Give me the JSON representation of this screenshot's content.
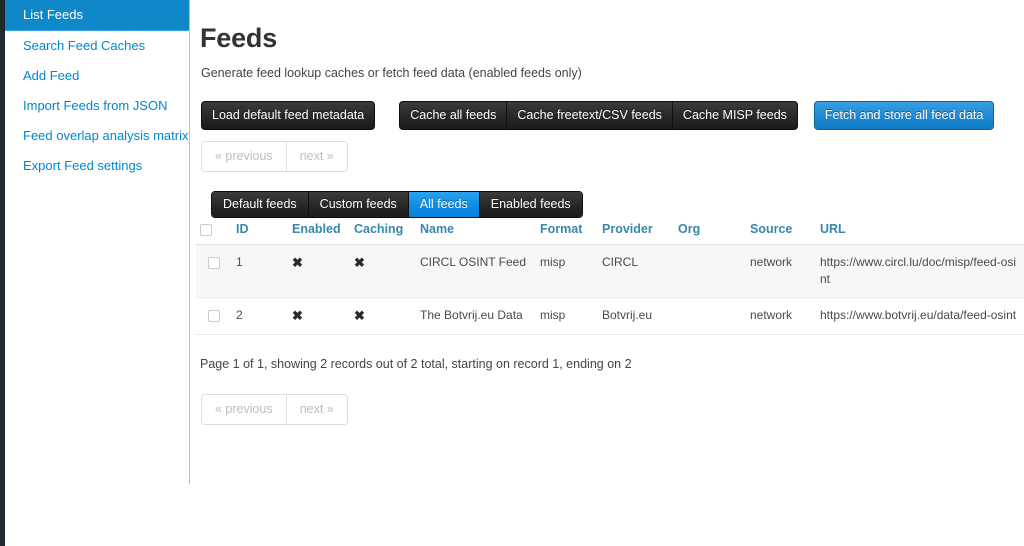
{
  "colors": {
    "accent_blue": "#0e88c8",
    "link_blue": "#0088cc",
    "header_link_blue": "#3a87ad",
    "dark_button": "#262626",
    "primary_button": "#1d86d0",
    "rail_dark": "#24282f",
    "stripe": "#f7f7f7"
  },
  "sidebar": {
    "items": [
      {
        "label": "List Feeds",
        "active": true
      },
      {
        "label": "Search Feed Caches",
        "active": false
      },
      {
        "label": "Add Feed",
        "active": false
      },
      {
        "label": "Import Feeds from JSON",
        "active": false
      },
      {
        "label": "Feed overlap analysis matrix",
        "active": false
      },
      {
        "label": "Export Feed settings",
        "active": false
      }
    ]
  },
  "main": {
    "title": "Feeds",
    "subtitle": "Generate feed lookup caches or fetch feed data (enabled feeds only)",
    "toolbar": {
      "load_default": "Load default feed metadata",
      "cache_all": "Cache all feeds",
      "cache_freetext": "Cache freetext/CSV feeds",
      "cache_misp": "Cache MISP feeds",
      "fetch_store": "Fetch and store all feed data"
    },
    "pagination": {
      "previous": "« previous",
      "next": "next »"
    },
    "tabs": [
      {
        "label": "Default feeds",
        "active": false
      },
      {
        "label": "Custom feeds",
        "active": false
      },
      {
        "label": "All feeds",
        "active": true
      },
      {
        "label": "Enabled feeds",
        "active": false
      }
    ],
    "table": {
      "columns": [
        "ID",
        "Enabled",
        "Caching",
        "Name",
        "Format",
        "Provider",
        "Org",
        "Source",
        "URL"
      ],
      "rows": [
        {
          "id": "1",
          "enabled": "✖",
          "caching": "✖",
          "name": "CIRCL OSINT Feed",
          "format": "misp",
          "provider": "CIRCL",
          "org": "",
          "source": "network",
          "url": "https://www.circl.lu/doc/misp/feed-osint"
        },
        {
          "id": "2",
          "enabled": "✖",
          "caching": "✖",
          "name": "The Botvrij.eu Data",
          "format": "misp",
          "provider": "Botvrij.eu",
          "org": "",
          "source": "network",
          "url": "https://www.botvrij.eu/data/feed-osint"
        }
      ]
    },
    "summary": "Page 1 of 1, showing 2 records out of 2 total, starting on record 1, ending on 2"
  }
}
